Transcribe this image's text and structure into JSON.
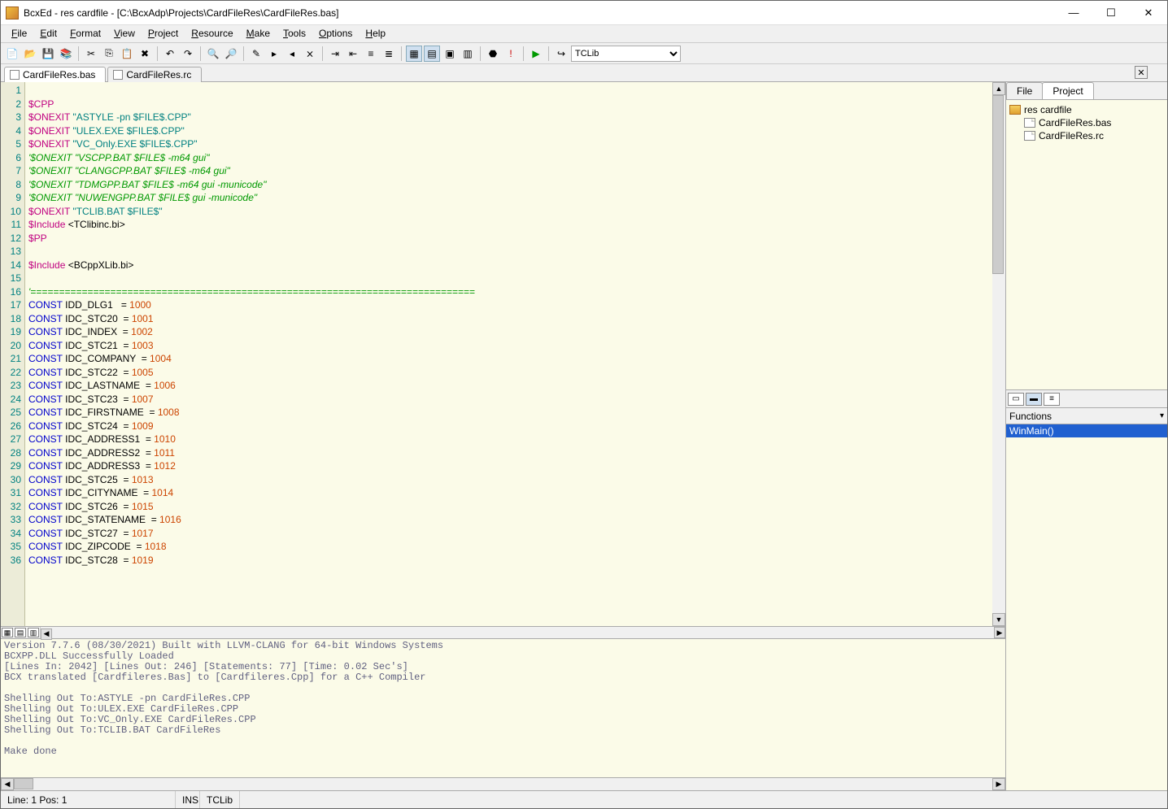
{
  "window": {
    "title": "BcxEd - res cardfile - [C:\\BcxAdp\\Projects\\CardFileRes\\CardFileRes.bas]"
  },
  "menu": [
    "File",
    "Edit",
    "Format",
    "View",
    "Project",
    "Resource",
    "Make",
    "Tools",
    "Options",
    "Help"
  ],
  "toolbar": {
    "compiler": "TCLib"
  },
  "tabs": [
    {
      "label": "CardFileRes.bas",
      "active": true
    },
    {
      "label": "CardFileRes.rc",
      "active": false
    }
  ],
  "code": {
    "lines": [
      {
        "n": 1,
        "tokens": []
      },
      {
        "n": 2,
        "tokens": [
          {
            "c": "dir",
            "t": "$CPP"
          }
        ]
      },
      {
        "n": 3,
        "tokens": [
          {
            "c": "dir",
            "t": "$ONEXIT "
          },
          {
            "c": "str",
            "t": "\"ASTYLE -pn $FILE$.CPP\""
          }
        ]
      },
      {
        "n": 4,
        "tokens": [
          {
            "c": "dir",
            "t": "$ONEXIT "
          },
          {
            "c": "str",
            "t": "\"ULEX.EXE $FILE$.CPP\""
          }
        ]
      },
      {
        "n": 5,
        "tokens": [
          {
            "c": "dir",
            "t": "$ONEXIT "
          },
          {
            "c": "str",
            "t": "\"VC_Only.EXE $FILE$.CPP\""
          }
        ]
      },
      {
        "n": 6,
        "tokens": [
          {
            "c": "cmt",
            "t": "'$ONEXIT \"VSCPP.BAT $FILE$ -m64 gui\""
          }
        ]
      },
      {
        "n": 7,
        "tokens": [
          {
            "c": "cmt",
            "t": "'$ONEXIT \"CLANGCPP.BAT $FILE$ -m64 gui\""
          }
        ]
      },
      {
        "n": 8,
        "tokens": [
          {
            "c": "cmt",
            "t": "'$ONEXIT \"TDMGPP.BAT $FILE$ -m64 gui -municode\""
          }
        ]
      },
      {
        "n": 9,
        "tokens": [
          {
            "c": "cmt",
            "t": "'$ONEXIT \"NUWENGPP.BAT $FILE$ gui -municode\""
          }
        ]
      },
      {
        "n": 10,
        "tokens": [
          {
            "c": "dir",
            "t": "$ONEXIT "
          },
          {
            "c": "str",
            "t": "\"TCLIB.BAT $FILE$\""
          }
        ]
      },
      {
        "n": 11,
        "tokens": [
          {
            "c": "dir",
            "t": "$Include "
          },
          {
            "c": "id",
            "t": "<TClibinc.bi>"
          }
        ]
      },
      {
        "n": 12,
        "tokens": [
          {
            "c": "dir",
            "t": "$PP"
          }
        ]
      },
      {
        "n": 13,
        "tokens": []
      },
      {
        "n": 14,
        "tokens": [
          {
            "c": "dir",
            "t": "$Include "
          },
          {
            "c": "id",
            "t": "<BCppXLib.bi>"
          }
        ]
      },
      {
        "n": 15,
        "tokens": []
      },
      {
        "n": 16,
        "tokens": [
          {
            "c": "cmt",
            "t": "'=============================================================================="
          }
        ]
      },
      {
        "n": 17,
        "tokens": [
          {
            "c": "kw",
            "t": "CONST "
          },
          {
            "c": "id",
            "t": "IDD_DLG1   = "
          },
          {
            "c": "num",
            "t": "1000"
          }
        ]
      },
      {
        "n": 18,
        "tokens": [
          {
            "c": "kw",
            "t": "CONST "
          },
          {
            "c": "id",
            "t": "IDC_STC20  = "
          },
          {
            "c": "num",
            "t": "1001"
          }
        ]
      },
      {
        "n": 19,
        "tokens": [
          {
            "c": "kw",
            "t": "CONST "
          },
          {
            "c": "id",
            "t": "IDC_INDEX  = "
          },
          {
            "c": "num",
            "t": "1002"
          }
        ]
      },
      {
        "n": 20,
        "tokens": [
          {
            "c": "kw",
            "t": "CONST "
          },
          {
            "c": "id",
            "t": "IDC_STC21  = "
          },
          {
            "c": "num",
            "t": "1003"
          }
        ]
      },
      {
        "n": 21,
        "tokens": [
          {
            "c": "kw",
            "t": "CONST "
          },
          {
            "c": "id",
            "t": "IDC_COMPANY  = "
          },
          {
            "c": "num",
            "t": "1004"
          }
        ]
      },
      {
        "n": 22,
        "tokens": [
          {
            "c": "kw",
            "t": "CONST "
          },
          {
            "c": "id",
            "t": "IDC_STC22  = "
          },
          {
            "c": "num",
            "t": "1005"
          }
        ]
      },
      {
        "n": 23,
        "tokens": [
          {
            "c": "kw",
            "t": "CONST "
          },
          {
            "c": "id",
            "t": "IDC_LASTNAME  = "
          },
          {
            "c": "num",
            "t": "1006"
          }
        ]
      },
      {
        "n": 24,
        "tokens": [
          {
            "c": "kw",
            "t": "CONST "
          },
          {
            "c": "id",
            "t": "IDC_STC23  = "
          },
          {
            "c": "num",
            "t": "1007"
          }
        ]
      },
      {
        "n": 25,
        "tokens": [
          {
            "c": "kw",
            "t": "CONST "
          },
          {
            "c": "id",
            "t": "IDC_FIRSTNAME  = "
          },
          {
            "c": "num",
            "t": "1008"
          }
        ]
      },
      {
        "n": 26,
        "tokens": [
          {
            "c": "kw",
            "t": "CONST "
          },
          {
            "c": "id",
            "t": "IDC_STC24  = "
          },
          {
            "c": "num",
            "t": "1009"
          }
        ]
      },
      {
        "n": 27,
        "tokens": [
          {
            "c": "kw",
            "t": "CONST "
          },
          {
            "c": "id",
            "t": "IDC_ADDRESS1  = "
          },
          {
            "c": "num",
            "t": "1010"
          }
        ]
      },
      {
        "n": 28,
        "tokens": [
          {
            "c": "kw",
            "t": "CONST "
          },
          {
            "c": "id",
            "t": "IDC_ADDRESS2  = "
          },
          {
            "c": "num",
            "t": "1011"
          }
        ]
      },
      {
        "n": 29,
        "tokens": [
          {
            "c": "kw",
            "t": "CONST "
          },
          {
            "c": "id",
            "t": "IDC_ADDRESS3  = "
          },
          {
            "c": "num",
            "t": "1012"
          }
        ]
      },
      {
        "n": 30,
        "tokens": [
          {
            "c": "kw",
            "t": "CONST "
          },
          {
            "c": "id",
            "t": "IDC_STC25  = "
          },
          {
            "c": "num",
            "t": "1013"
          }
        ]
      },
      {
        "n": 31,
        "tokens": [
          {
            "c": "kw",
            "t": "CONST "
          },
          {
            "c": "id",
            "t": "IDC_CITYNAME  = "
          },
          {
            "c": "num",
            "t": "1014"
          }
        ]
      },
      {
        "n": 32,
        "tokens": [
          {
            "c": "kw",
            "t": "CONST "
          },
          {
            "c": "id",
            "t": "IDC_STC26  = "
          },
          {
            "c": "num",
            "t": "1015"
          }
        ]
      },
      {
        "n": 33,
        "tokens": [
          {
            "c": "kw",
            "t": "CONST "
          },
          {
            "c": "id",
            "t": "IDC_STATENAME  = "
          },
          {
            "c": "num",
            "t": "1016"
          }
        ]
      },
      {
        "n": 34,
        "tokens": [
          {
            "c": "kw",
            "t": "CONST "
          },
          {
            "c": "id",
            "t": "IDC_STC27  = "
          },
          {
            "c": "num",
            "t": "1017"
          }
        ]
      },
      {
        "n": 35,
        "tokens": [
          {
            "c": "kw",
            "t": "CONST "
          },
          {
            "c": "id",
            "t": "IDC_ZIPCODE  = "
          },
          {
            "c": "num",
            "t": "1018"
          }
        ]
      },
      {
        "n": 36,
        "tokens": [
          {
            "c": "kw",
            "t": "CONST "
          },
          {
            "c": "id",
            "t": "IDC_STC28  = "
          },
          {
            "c": "num",
            "t": "1019"
          }
        ]
      }
    ]
  },
  "output": [
    "Version 7.7.6 (08/30/2021) Built with LLVM-CLANG for 64-bit Windows Systems",
    "BCXPP.DLL Successfully Loaded",
    "[Lines In: 2042] [Lines Out: 246] [Statements: 77] [Time: 0.02 Sec's]",
    "BCX translated [Cardfileres.Bas] to [Cardfileres.Cpp] for a C++ Compiler",
    "",
    "Shelling Out To:ASTYLE -pn CardFileRes.CPP",
    "Shelling Out To:ULEX.EXE CardFileRes.CPP",
    "Shelling Out To:VC_Only.EXE CardFileRes.CPP",
    "Shelling Out To:TCLIB.BAT CardFileRes",
    "",
    "Make done"
  ],
  "sidetabs": [
    {
      "label": "File",
      "active": false
    },
    {
      "label": "Project",
      "active": true
    }
  ],
  "tree": {
    "root": "res cardfile",
    "files": [
      "CardFileRes.bas",
      "CardFileRes.rc"
    ]
  },
  "functions": {
    "label": "Functions",
    "items": [
      "WinMain()"
    ]
  },
  "status": {
    "pos": "Line: 1 Pos: 1",
    "ins": "INS",
    "compiler": "TCLib"
  }
}
